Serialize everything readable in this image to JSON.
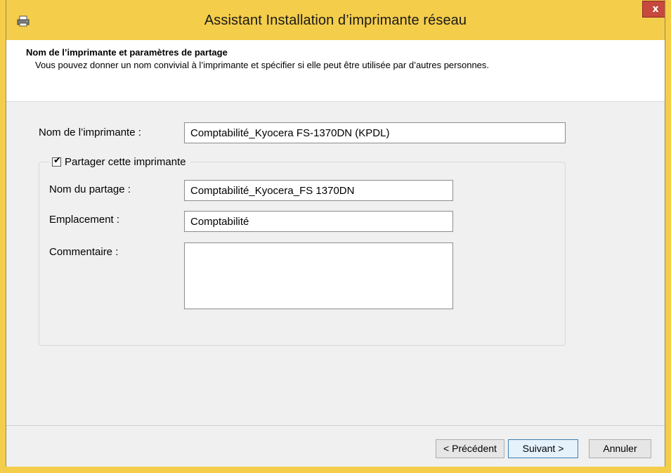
{
  "window": {
    "title": "Assistant Installation d’imprimante réseau",
    "icon": "printer-icon",
    "close_label": "x",
    "frame_color": "#f4cd4a",
    "close_color": "#c7483d"
  },
  "header": {
    "title": "Nom de l’imprimante et paramètres de partage",
    "description": "Vous pouvez donner un nom convivial à l’imprimante et spécifier si elle peut être utilisée par d’autres personnes."
  },
  "form": {
    "printer_name_label": "Nom de l’imprimante :",
    "printer_name_value": "Comptabilité_Kyocera FS-1370DN (KPDL)",
    "share_checkbox_label": "Partager cette imprimante",
    "share_checked": true,
    "share_name_label": "Nom du partage :",
    "share_name_value": "Comptabilité_Kyocera_FS 1370DN",
    "location_label": "Emplacement :",
    "location_value": "Comptabilité",
    "comment_label": "Commentaire :",
    "comment_value": ""
  },
  "buttons": {
    "previous": "< Précédent",
    "next": "Suivant >",
    "cancel": "Annuler"
  }
}
